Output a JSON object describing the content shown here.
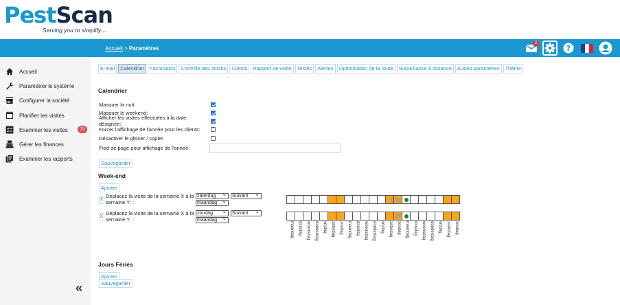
{
  "logo": {
    "brand_a": "Pest",
    "brand_b": "Scan",
    "tagline": "Serving you to simplify",
    "tagline_dot": "..."
  },
  "breadcrumb": {
    "home": "Accueil",
    "sep": " > ",
    "current": "Paramètres"
  },
  "topbar": {
    "mail_count": "2",
    "colors": {
      "bar": "#1a98cf"
    }
  },
  "sidebar": {
    "items": [
      {
        "label": "Accueil",
        "icon": "home-icon"
      },
      {
        "label": "Paramétrer le système",
        "icon": "wrench-icon"
      },
      {
        "label": "Configurer la société",
        "icon": "store-icon"
      },
      {
        "label": "Planifier les visites",
        "icon": "calendar-icon"
      },
      {
        "label": "Examiner les visites",
        "icon": "checklist-icon",
        "badge": "73"
      },
      {
        "label": "Gérer les finances",
        "icon": "register-icon"
      },
      {
        "label": "Examiner les rapports",
        "icon": "reports-icon"
      }
    ],
    "collapse": "«"
  },
  "tabs": [
    "E-mail",
    "Calendrier",
    "Facturation",
    "Contrôle des stocks",
    "Clients",
    "Rapport de visite",
    "Textes",
    "Alertes",
    "Optimisation de la route",
    "Surveillance à distance",
    "Autres paramètres",
    "Thème"
  ],
  "active_tab": "Calendrier",
  "calendar": {
    "title": "Calendrier",
    "options": [
      {
        "label": "Masquer la nuit:",
        "checked": true
      },
      {
        "label": "Masquer le weekend:",
        "checked": true
      },
      {
        "label": "Afficher les visites effectuées à la date désignée:",
        "checked": true
      },
      {
        "label": "Forcer l'affichage de l'année pour les clients:",
        "checked": false
      },
      {
        "label": "Désactiver le glisser / copier",
        "checked": false
      }
    ],
    "footer_label": "Pied de page pour affichage de l'année:",
    "save": "Sauvegarder"
  },
  "weekend": {
    "title": "Week-end",
    "add": "Ajouter",
    "rules": [
      {
        "remove": "X",
        "text": "Déplacez la visite de la semaine X à la semaine Y: :",
        "day_from": "zaterdag",
        "direction": "Suivant",
        "day_to": "maandag"
      },
      {
        "remove": "X",
        "text": "Déplacez la visite de la semaine X à la semaine Y: :",
        "day_from": "zondag",
        "direction": "Suivant",
        "day_to": "maandag"
      }
    ],
    "days": [
      "maandag",
      "dinsdag",
      "woensdag",
      "donderdag",
      "vrijdag",
      "zaterdag",
      "zondag",
      "maandag",
      "dinsdag",
      "woensdag",
      "donderdag",
      "vrijdag",
      "zaterdag",
      "zondag",
      "maandag",
      "dinsdag",
      "woensdag",
      "donderdag",
      "vrijdag",
      "zaterdag",
      "zondag"
    ],
    "strip1": {
      "orange": [
        5,
        6,
        12,
        13,
        19,
        20
      ],
      "gray": [
        12,
        13
      ],
      "green": [
        14
      ]
    },
    "strip2": {
      "orange": [
        5,
        6,
        12,
        13,
        19,
        20
      ],
      "gray": [
        13
      ],
      "green": [
        14
      ]
    },
    "colors": {
      "weekend": "#f7a51c",
      "moved": "#a7b3bf",
      "target": "#1e7e52"
    }
  },
  "holidays": {
    "title": "Jours Fériés",
    "add": "Ajouter",
    "save": "Sauvegarder"
  }
}
